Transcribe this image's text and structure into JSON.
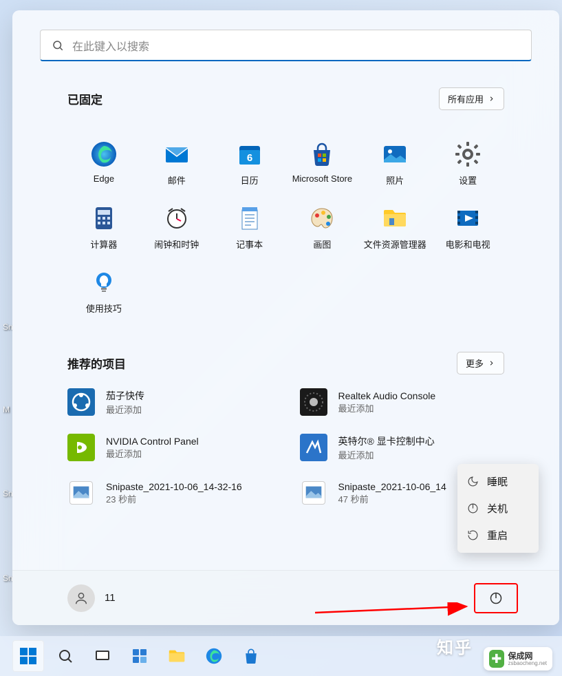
{
  "search": {
    "placeholder": "在此键入以搜索"
  },
  "pinned": {
    "title": "已固定",
    "all_apps": "所有应用",
    "items": [
      {
        "label": "Edge"
      },
      {
        "label": "邮件"
      },
      {
        "label": "日历"
      },
      {
        "label": "Microsoft Store"
      },
      {
        "label": "照片"
      },
      {
        "label": "设置"
      },
      {
        "label": "计算器"
      },
      {
        "label": "闹钟和时钟"
      },
      {
        "label": "记事本"
      },
      {
        "label": "画图"
      },
      {
        "label": "文件资源管理器"
      },
      {
        "label": "电影和电视"
      },
      {
        "label": "使用技巧"
      }
    ]
  },
  "recommended": {
    "title": "推荐的项目",
    "more": "更多",
    "items": [
      {
        "title": "茄子快传",
        "sub": "最近添加"
      },
      {
        "title": "Realtek Audio Console",
        "sub": "最近添加"
      },
      {
        "title": "NVIDIA Control Panel",
        "sub": "最近添加"
      },
      {
        "title": "英特尔® 显卡控制中心",
        "sub": "最近添加"
      },
      {
        "title": "Snipaste_2021-10-06_14-32-16",
        "sub": "23 秒前"
      },
      {
        "title": "Snipaste_2021-10-06_14",
        "sub": "47 秒前"
      }
    ]
  },
  "user": {
    "name": "11"
  },
  "power_menu": {
    "sleep": "睡眠",
    "shutdown": "关机",
    "restart": "重启"
  },
  "desktop_labels": [
    "Sn",
    "M",
    "Sn",
    "Sn"
  ],
  "watermark": {
    "name": "保成网",
    "url": "zsbaocheng.net"
  },
  "zhihu_text": "知乎"
}
